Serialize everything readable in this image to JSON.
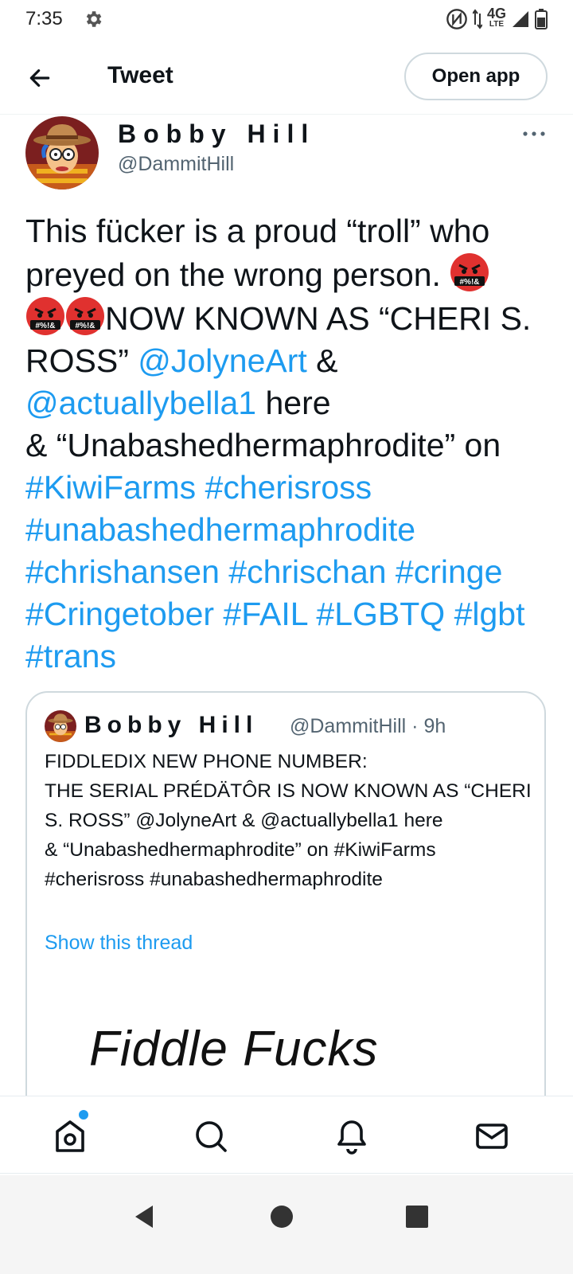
{
  "status_bar": {
    "time": "7:35",
    "network": "4G",
    "network_sub": "LTE",
    "icons": [
      "settings-icon",
      "nfc-icon",
      "data-arrows-icon",
      "signal-icon",
      "battery-icon"
    ]
  },
  "header": {
    "title": "Tweet",
    "open_app_label": "Open app",
    "back_icon": "arrow-left-icon"
  },
  "tweet": {
    "author_name": "Bobby Hill",
    "author_handle": "@DammitHill",
    "text": {
      "p1": "This fücker is a proud “troll” who preyed on the wrong person. ",
      "p2": "NOW KNOWN AS “CHERI S. ROSS” ",
      "mention1": "@JolyneArt",
      "amp": " & ",
      "mention2": "@actuallybella1",
      "p3": " here",
      "p4": "& “Unabashedhermaphrodite” on ",
      "hashtags": "#KiwiFarms #cherisross #unabashedhermaphrodite #chrishansen #chrischan #cringe #Cringetober #FAIL #LGBTQ #lgbt #trans"
    },
    "emoji_label": "#%!&"
  },
  "quote": {
    "author_name": "Bobby Hill",
    "author_handle": "@DammitHill",
    "time": "· 9h",
    "text": "FIDDLEDIX NEW PHONE NUMBER:\nTHE SERIAL PRÉDÄTÔR IS NOW KNOWN AS “CHERI S. ROSS” @JolyneArt & @actuallybella1 here\n& “Unabashedhermaphrodite” on #KiwiFarms #cherisross #unabashedhermaphrodite",
    "show_thread": "Show this thread",
    "media_text": "Fiddle Fucks"
  },
  "bottom_nav": {
    "items": [
      "home-icon",
      "search-icon",
      "notifications-icon",
      "messages-icon"
    ],
    "accent": "#1d9bf0"
  },
  "system_nav": {
    "items": [
      "back-triangle-icon",
      "home-circle-icon",
      "recents-square-icon"
    ]
  }
}
